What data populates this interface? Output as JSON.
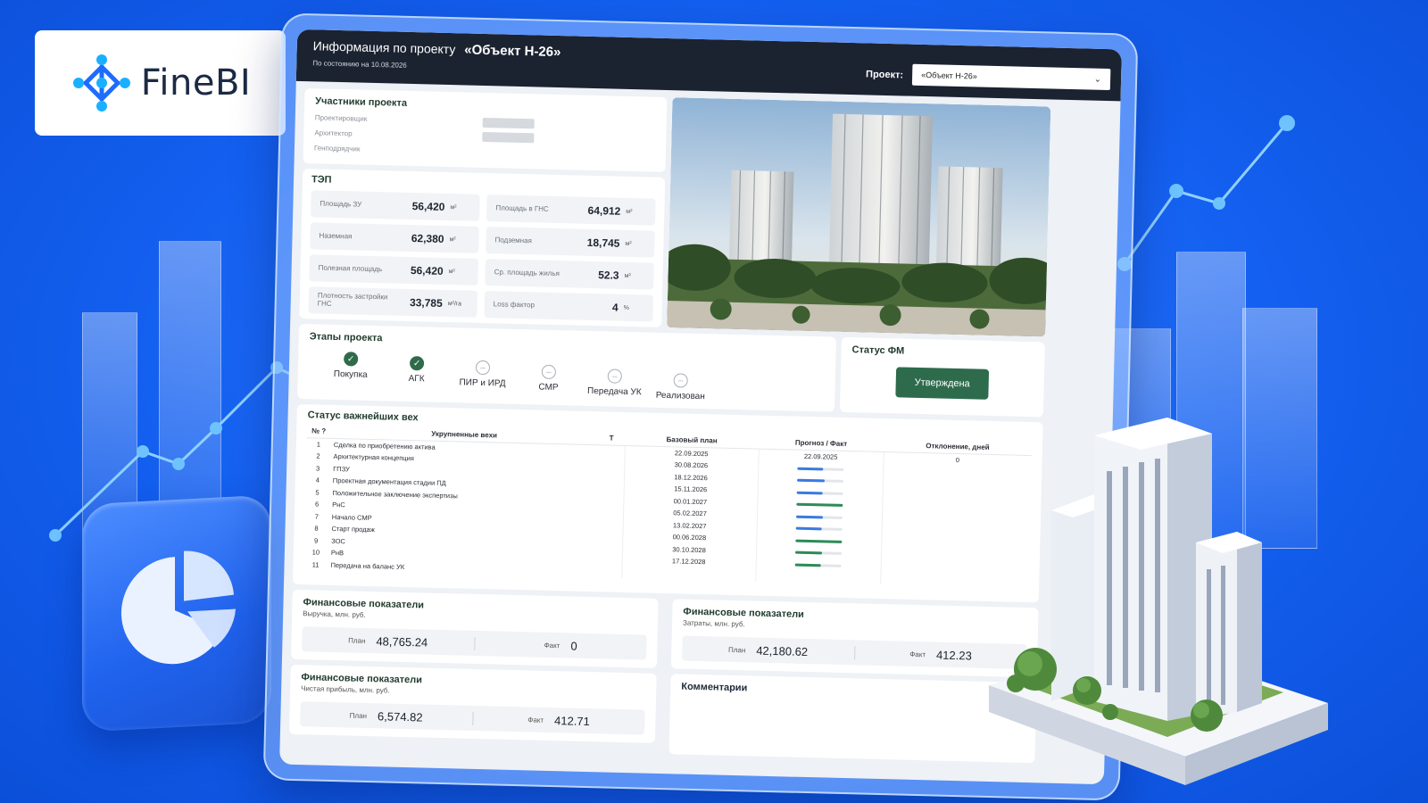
{
  "brand": {
    "name": "FineBI",
    "accent": "#1e6cff"
  },
  "header": {
    "title_prefix": "Информация по проекту",
    "project_name": "«Объект Н-26»",
    "as_of": "По состоянию на 10.08.2026",
    "project_label": "Проект:",
    "project_selected": "«Объект Н-26»"
  },
  "participants": {
    "title": "Участники проекта",
    "rows": [
      "Проектировщик",
      "Архитектор",
      "Генподрядчик"
    ]
  },
  "tep": {
    "title": "ТЭП",
    "cells": [
      {
        "label": "Площадь ЗУ",
        "value": "56,420",
        "unit": "м²"
      },
      {
        "label": "Площадь в ГНС",
        "value": "64,912",
        "unit": "м²"
      },
      {
        "label": "Наземная",
        "value": "62,380",
        "unit": "м²"
      },
      {
        "label": "Подземная",
        "value": "18,745",
        "unit": "м²"
      },
      {
        "label": "Полезная площадь",
        "value": "56,420",
        "unit": "м²"
      },
      {
        "label": "Ср. площадь жилья",
        "value": "52.3",
        "unit": "м²"
      },
      {
        "label": "Плотность застройки ГНС",
        "value": "33,785",
        "unit": "м²/га"
      },
      {
        "label": "Loss фактор",
        "value": "4",
        "unit": "%"
      }
    ]
  },
  "stages": {
    "title": "Этапы проекта",
    "items": [
      {
        "label": "Покупка",
        "done": true
      },
      {
        "label": "АГК",
        "done": true
      },
      {
        "label": "ПИР и ИРД",
        "done": false
      },
      {
        "label": "СМР",
        "done": false
      },
      {
        "label": "Передача УК",
        "done": false
      },
      {
        "label": "Реализован",
        "done": false
      }
    ]
  },
  "fm_status": {
    "title": "Статус ФМ",
    "button": "Утверждена",
    "color": "#2e6b4d"
  },
  "milestones": {
    "title": "Статус важнейших вех",
    "columns": {
      "num": "№ ?",
      "name": "Укрупненные вехи",
      "t": "Т",
      "base": "Базовый план",
      "forecast": "Прогноз / Факт",
      "deviation": "Отклонение, дней"
    },
    "rows": [
      {
        "num": "1",
        "name": "Сделка по приобретению актива",
        "base": "22.09.2025",
        "forecast": "22.09.2025",
        "progress": 0,
        "color": "",
        "deviation": "0"
      },
      {
        "num": "2",
        "name": "Архитектурная концепция",
        "base": "30.08.2026",
        "forecast": "",
        "progress": 0.55,
        "color": "#3a7be0",
        "deviation": ""
      },
      {
        "num": "3",
        "name": "ГПЗУ",
        "base": "18.12.2026",
        "forecast": "",
        "progress": 0.6,
        "color": "#3a7be0",
        "deviation": ""
      },
      {
        "num": "4",
        "name": "Проектная документация стадии ПД",
        "base": "15.11.2026",
        "forecast": "",
        "progress": 0.55,
        "color": "#3a7be0",
        "deviation": ""
      },
      {
        "num": "5",
        "name": "Положительное заключение экспертизы",
        "base": "00.01.2027",
        "forecast": "",
        "progress": 1,
        "color": "#2e8b57",
        "deviation": ""
      },
      {
        "num": "6",
        "name": "РнС",
        "base": "05.02.2027",
        "forecast": "",
        "progress": 0.58,
        "color": "#3a7be0",
        "deviation": ""
      },
      {
        "num": "7",
        "name": "Начало СМР",
        "base": "13.02.2027",
        "forecast": "",
        "progress": 0.55,
        "color": "#3a7be0",
        "deviation": ""
      },
      {
        "num": "8",
        "name": "Старт продаж",
        "base": "00.06.2028",
        "forecast": "",
        "progress": 1,
        "color": "#2e8b57",
        "deviation": ""
      },
      {
        "num": "9",
        "name": "ЗОС",
        "base": "30.10.2028",
        "forecast": "",
        "progress": 0.58,
        "color": "#2e8b57",
        "deviation": ""
      },
      {
        "num": "10",
        "name": "РнВ",
        "base": "17.12.2028",
        "forecast": "",
        "progress": 0.55,
        "color": "#2e8b57",
        "deviation": ""
      },
      {
        "num": "11",
        "name": "Передача на баланс УК",
        "base": "",
        "forecast": "",
        "progress": 0,
        "color": "",
        "deviation": ""
      }
    ]
  },
  "finance": {
    "revenue": {
      "title": "Финансовые показатели",
      "subtitle": "Выручка, млн. руб.",
      "plan_label": "План",
      "plan": "48,765.24",
      "fact_label": "Факт",
      "fact": "0"
    },
    "costs": {
      "title": "Финансовые показатели",
      "subtitle": "Затраты, млн. руб.",
      "plan_label": "План",
      "plan": "42,180.62",
      "fact_label": "Факт",
      "fact": "412.23"
    },
    "profit": {
      "title": "Финансовые показатели",
      "subtitle": "Чистая прибыль, млн. руб.",
      "plan_label": "План",
      "plan": "6,574.82",
      "fact_label": "Факт",
      "fact": "412.71"
    }
  },
  "comments": {
    "title": "Комментарии"
  }
}
